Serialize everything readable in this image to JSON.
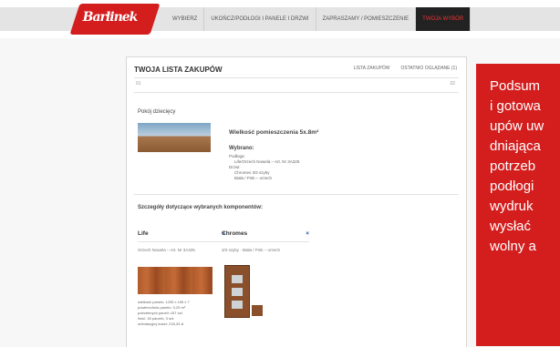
{
  "brand": {
    "logo_text": "Barlinek"
  },
  "nav": [
    {
      "label": "WYBIERZ"
    },
    {
      "label": "UKOŃCZ/PODŁOGI I PANELE I DRZWI"
    },
    {
      "label": "ZAPRASZAMY / POMIESZCZENIE"
    },
    {
      "label": "TWOJA WYBÓR",
      "active": true
    }
  ],
  "panel": {
    "title": "TWOJA LISTA ZAKUPÓW",
    "links": [
      "LISTA ZAKUPÓW",
      "OSTATNIO OGLĄDANE (1)"
    ],
    "nav_left": "01",
    "nav_right": "02",
    "room_name": "Pokój dziecięcy",
    "area_label": "Wielkość pomieszczenia 5x.8m²",
    "chosen_label": "Wybrano:",
    "selection": [
      "Podłoga:",
      "Life/Orzech Nowela – Art. Nr 3A325",
      "Drzwi:",
      "Chromes 3/3 szyby",
      "Biała / Pink – orzech"
    ],
    "segments_title": "Szczegóły dotyczące wybranych komponentów:",
    "columns": [
      {
        "name": "Life",
        "sub": "Orzech Nowela – Art. Nr 3A325",
        "close": "×"
      },
      {
        "name": "Chromes",
        "sub": "3/3 szyby · Biała / Pink – orzech",
        "close": "×"
      }
    ],
    "specs": [
      "wielkość panelu: 1295 x 196 x 7",
      "powierzchnia panelu: 0,25 m²",
      "potrzebnych paneli: 167 szt.",
      "ilość: 18 paczek, 3 szt.",
      "orientacyjny koszt: 218,33 zł"
    ]
  },
  "callout_lines": [
    "Podsum",
    "i gotowa",
    "upów uw",
    "dniająca",
    "potrzeb",
    "podłogi",
    "wydruk",
    "wysłać",
    "wolny a"
  ],
  "colors": {
    "brand_red": "#d41e1e",
    "active_nav_bg": "#222222",
    "link_blue": "#1f5aa6"
  }
}
